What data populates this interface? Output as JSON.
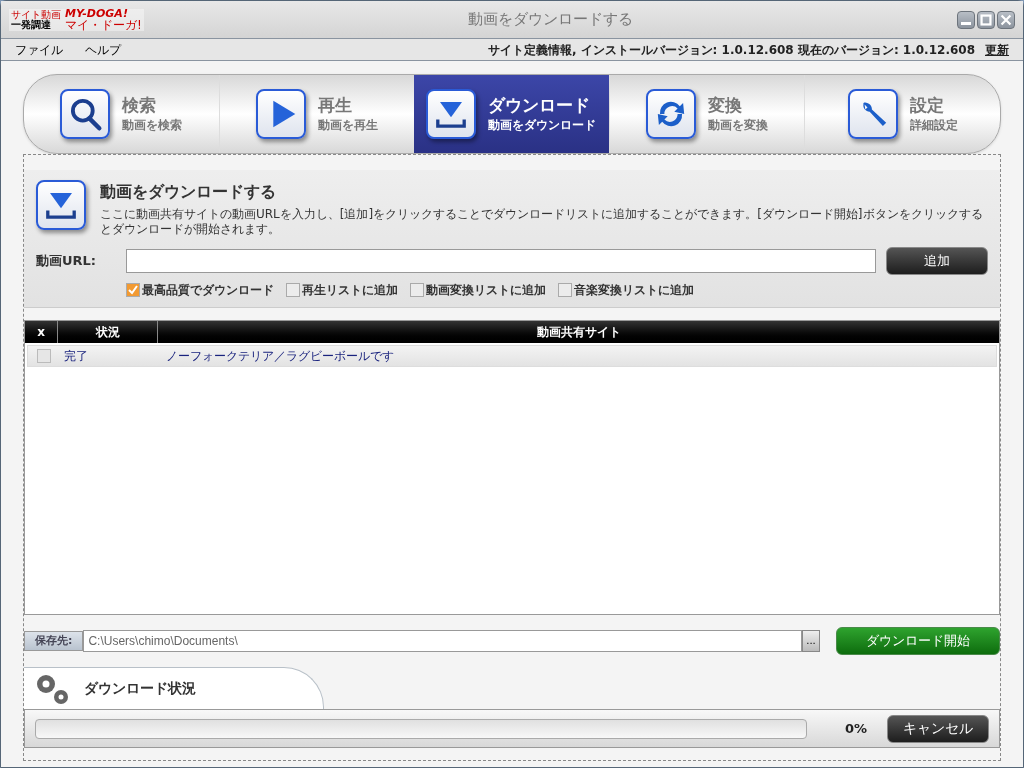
{
  "window": {
    "title": "動画をダウンロードする",
    "logo": {
      "tagline_top": "サイト動画",
      "tagline_bottom": "一発調達",
      "name": "MY-DOGA!",
      "reading": "マイ・ドーガ!"
    }
  },
  "menu": [
    "ファイル",
    "ヘルプ"
  ],
  "version_info": "サイト定義情報, インストールバージョン: 1.0.12.608 現在のバージョン: 1.0.12.608",
  "update_link": "更新",
  "tabs": [
    {
      "kind": "search",
      "label": "検索",
      "sub": "動画を検索",
      "selected": false
    },
    {
      "kind": "play",
      "label": "再生",
      "sub": "動画を再生",
      "selected": false
    },
    {
      "kind": "download",
      "label": "ダウンロード",
      "sub": "動画をダウンロード",
      "selected": true
    },
    {
      "kind": "convert",
      "label": "変換",
      "sub": "動画を変換",
      "selected": false
    },
    {
      "kind": "settings",
      "label": "設定",
      "sub": "詳細設定",
      "selected": false
    }
  ],
  "section": {
    "title": "動画をダウンロードする",
    "description": "ここに動画共有サイトの動画URLを入力し、[追加]をクリックすることでダウンロードリストに追加することができます。[ダウンロード開始]ボタンをクリックするとダウンロードが開始されます。"
  },
  "url_label": "動画URL:",
  "add_button": "追加",
  "options": [
    {
      "label": "最高品質でダウンロード",
      "checked": true
    },
    {
      "label": "再生リストに追加",
      "checked": false
    },
    {
      "label": "動画変換リストに追加",
      "checked": false
    },
    {
      "label": "音楽変換リストに追加",
      "checked": false
    }
  ],
  "table": {
    "columns": [
      "x",
      "状況",
      "動画共有サイト"
    ],
    "rows": [
      {
        "checked": false,
        "status": "完了",
        "title": "ノーフォークテリア／ラグビーボールです"
      }
    ]
  },
  "save": {
    "label": "保存先:",
    "path": "C:\\Users\\chimo\\Documents\\",
    "browse": "...",
    "start_button": "ダウンロード開始"
  },
  "progress": {
    "title": "ダウンロード状況",
    "level": 0,
    "percent": "0%",
    "cancel_button": "キャンセル"
  }
}
